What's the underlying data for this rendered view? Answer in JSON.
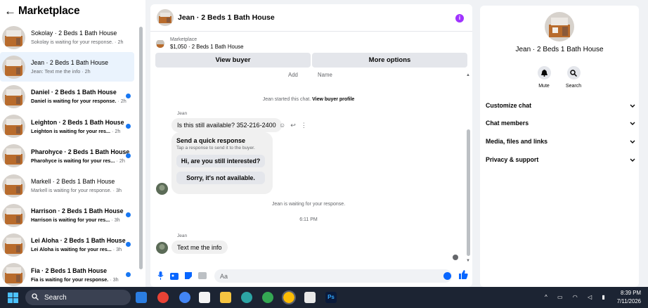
{
  "left_panel": {
    "back_glyph": "←",
    "title": "Marketplace",
    "conversations": [
      {
        "name": "Sokolay · 2 Beds 1 Bath House",
        "preview": "Sokolay is waiting for your response.",
        "time": " · 2h",
        "unread": false,
        "active": false
      },
      {
        "name": "Jean · 2 Beds 1 Bath House",
        "preview": "Jean: Text me the info",
        "time": " · 2h",
        "unread": false,
        "active": true
      },
      {
        "name": "Daniel · 2 Beds 1 Bath House",
        "preview": "Daniel is waiting for your response.",
        "time": " · 2h",
        "unread": true,
        "active": false
      },
      {
        "name": "Leighton · 2 Beds 1 Bath House",
        "preview": "Leighton is waiting for your res...",
        "time": " · 2h",
        "unread": true,
        "active": false
      },
      {
        "name": "Pharohyce · 2 Beds 1 Bath House",
        "preview": "Pharohyce is waiting for your res...",
        "time": " · 2h",
        "unread": true,
        "active": false
      },
      {
        "name": "Markell · 2 Beds 1 Bath House",
        "preview": "Markell is waiting for your response.",
        "time": " · 3h",
        "unread": false,
        "active": false
      },
      {
        "name": "Harrison · 2 Beds 1 Bath House",
        "preview": "Harrison is waiting for your res...",
        "time": " · 3h",
        "unread": true,
        "active": false
      },
      {
        "name": "Lei Aloha · 2 Beds 1 Bath House",
        "preview": "Lei Aloha is waiting for your res...",
        "time": " · 3h",
        "unread": true,
        "active": false
      },
      {
        "name": "Fia · 2 Beds 1 Bath House",
        "preview": "Fia is waiting for your response.",
        "time": " · 3h",
        "unread": true,
        "active": false
      }
    ]
  },
  "chat": {
    "title": "Jean · 2 Beds 1 Bath House",
    "marketplace_label": "Marketplace",
    "listing": "$1,050 · 2 Beds 1 Bath House",
    "view_buyer": "View buyer",
    "more_options": "More options",
    "table_headers": [
      "Add",
      "Name"
    ],
    "started_text": "Jean started this chat. ",
    "view_profile": "View buyer profile",
    "sender": "Jean",
    "message1": "Is this still available? 352-216-2400",
    "quick_title": "Send a quick response",
    "quick_sub": "Tap a response to send it to the buyer.",
    "quick_options": [
      "Hi, are you still interested?",
      "Sorry, it's not available."
    ],
    "waiting_text": "Jean is waiting for your response.",
    "timestamp": "6:11 PM",
    "message2": "Text me the info",
    "composer_placeholder": "Aa"
  },
  "right_panel": {
    "name": "Jean · 2 Beds 1 Bath House",
    "mute": "Mute",
    "search": "Search",
    "sections": [
      "Customize chat",
      "Chat members",
      "Media, files and links",
      "Privacy & support"
    ]
  },
  "taskbar": {
    "search": "Search",
    "time": "8:39 PM",
    "date": "7/11/2026"
  },
  "colors": {
    "accent": "#0866ff",
    "unread_dot": "#1877f2",
    "purple_badge": "#a033ff"
  }
}
